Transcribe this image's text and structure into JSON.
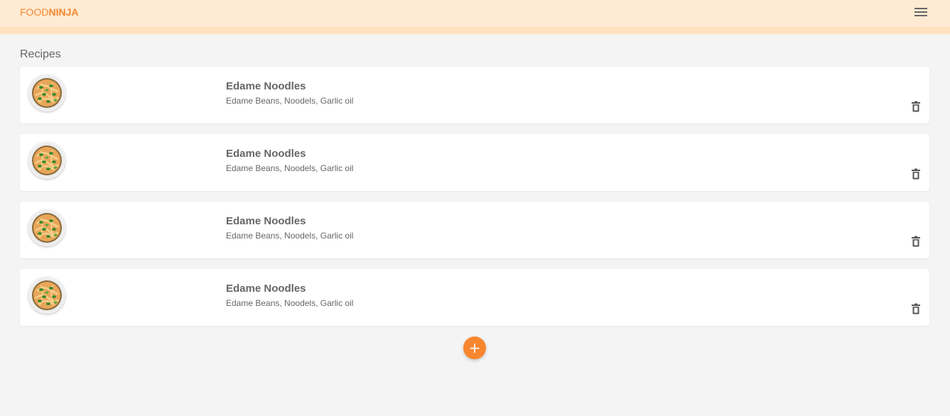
{
  "app": {
    "brand_light": "FOOD",
    "brand_bold": "NINJA"
  },
  "colors": {
    "accent": "#f7862e",
    "navbar_bg": "#ffebd3",
    "navbar_border": "#ffe0bd",
    "page_bg": "#f4f4f4",
    "text": "#666666"
  },
  "icons": {
    "menu": "hamburger-menu-icon",
    "delete": "trash-icon",
    "add": "plus-icon"
  },
  "main": {
    "title": "Recipes",
    "add_label": "+"
  },
  "recipes": [
    {
      "title": "Edame Noodles",
      "ingredients": "Edame Beans, Noodels, Garlic oil"
    },
    {
      "title": "Edame Noodles",
      "ingredients": "Edame Beans, Noodels, Garlic oil"
    },
    {
      "title": "Edame Noodles",
      "ingredients": "Edame Beans, Noodels, Garlic oil"
    },
    {
      "title": "Edame Noodles",
      "ingredients": "Edame Beans, Noodels, Garlic oil"
    }
  ]
}
